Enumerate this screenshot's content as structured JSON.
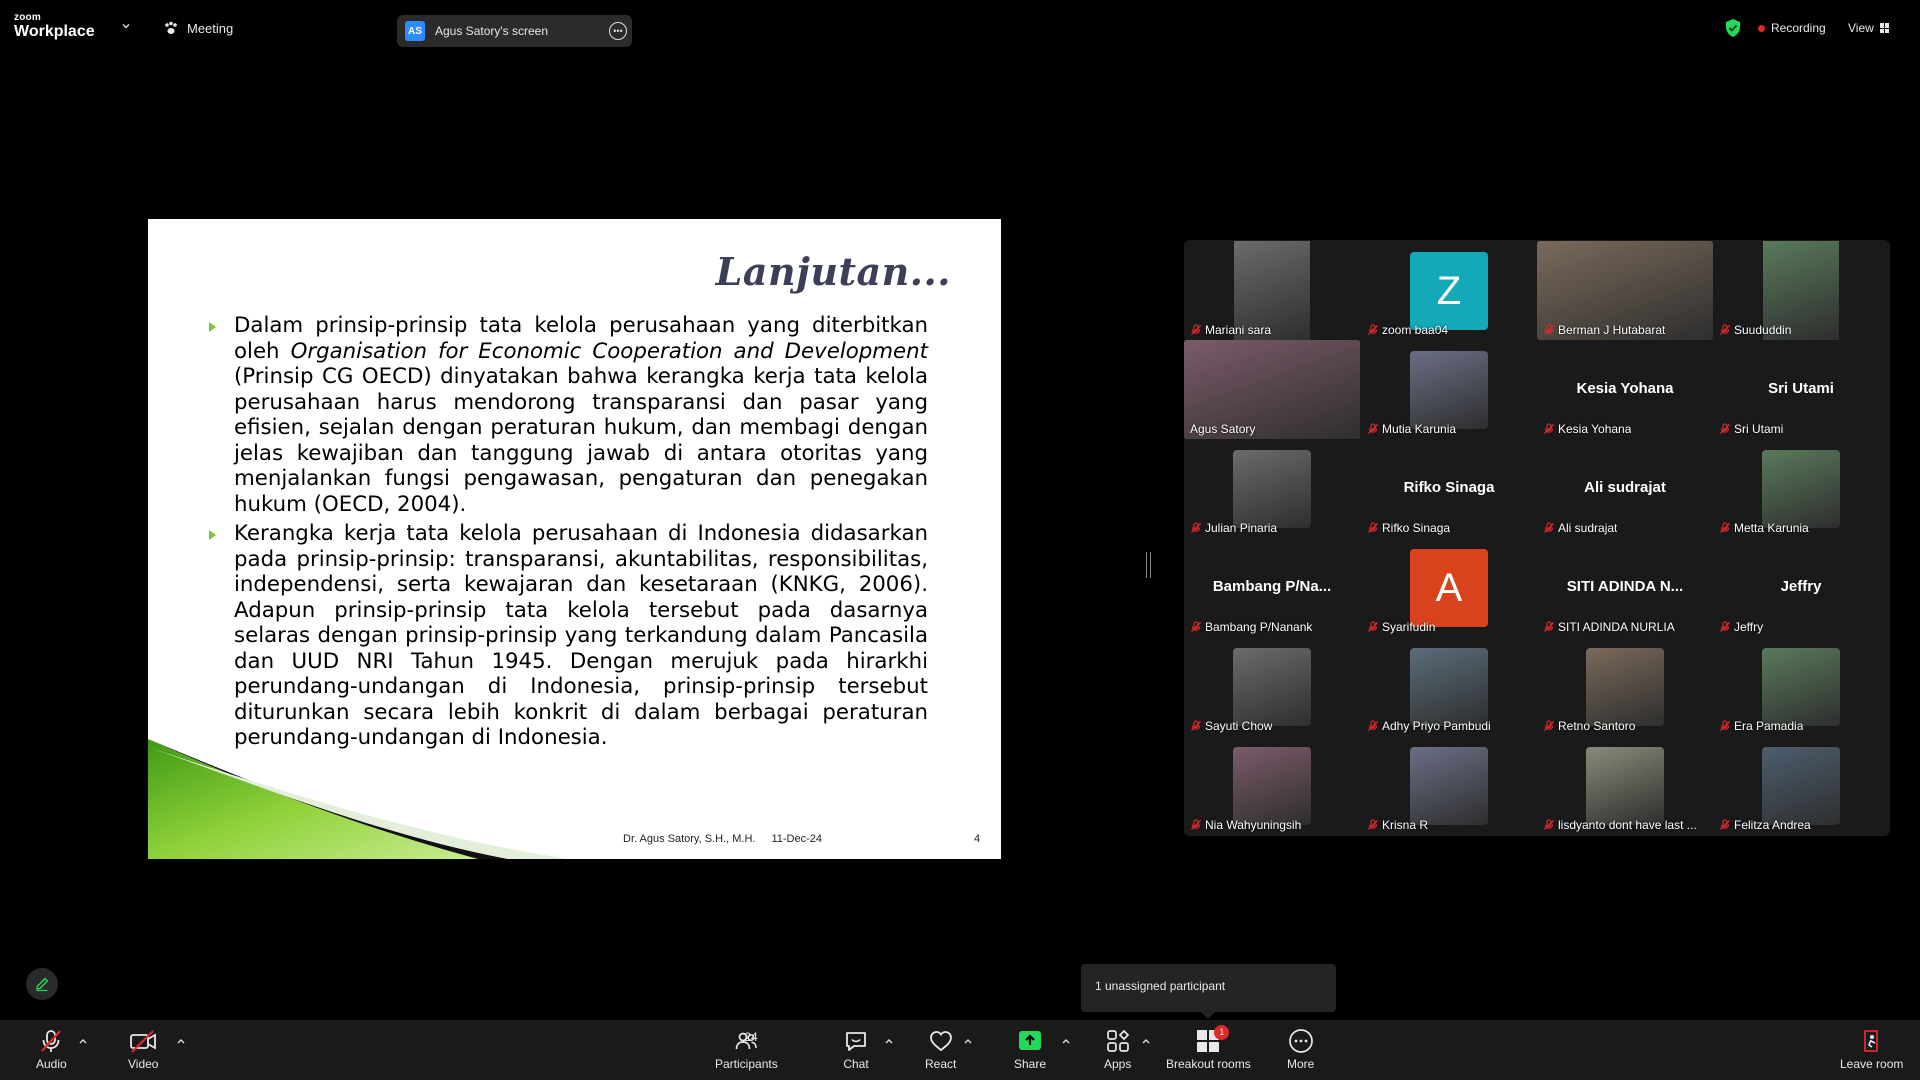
{
  "app": {
    "brand_small": "zoom",
    "brand_large": "Workplace",
    "meeting_label": "Meeting"
  },
  "screen_share": {
    "initials": "AS",
    "label": "Agus Satory's screen"
  },
  "status": {
    "recording_label": "Recording",
    "view_label": "View"
  },
  "slide": {
    "title": "Lanjutan...",
    "bullet1_pre": "Dalam prinsip-prinsip tata kelola perusahaan yang diterbitkan oleh ",
    "bullet1_italic": "Organisation for Economic Cooperation and Development",
    "bullet1_post": " (Prinsip CG OECD) dinyatakan bahwa kerangka kerja tata kelola perusahaan harus mendorong transparansi dan pasar yang efisien, sejalan dengan peraturan hukum, dan membagi dengan jelas kewajiban dan tanggung jawab di antara otoritas yang menjalankan fungsi pengawasan, pengaturan dan penegakan hukum (OECD, 2004).",
    "bullet2": "Kerangka kerja tata kelola perusahaan di Indonesia didasarkan pada prinsip-prinsip: transparansi, akuntabilitas, responsibilitas, independensi, serta kewajaran dan kesetaraan (KNKG, 2006). Adapun prinsip-prinsip tata kelola tersebut pada dasarnya selaras dengan prinsip-prinsip yang terkandung dalam Pancasila dan UUD NRI Tahun 1945. Dengan merujuk pada hirarkhi perundang-undangan di Indonesia, prinsip-prinsip tersebut diturunkan secara lebih konkrit di dalam berbagai peraturan perundang-undangan di Indonesia.",
    "footer_author": "Dr. Agus Satory, S.H., M.H.",
    "footer_date": "11-Dec-24",
    "page_number": "4"
  },
  "participants": [
    {
      "name": "Mariani sara",
      "kind": "video"
    },
    {
      "name": "zoom baa04",
      "kind": "letter",
      "letter": "Z",
      "color": "#14a9b8"
    },
    {
      "name": "Berman J Hutabarat",
      "kind": "video"
    },
    {
      "name": "Suududdin",
      "kind": "video"
    },
    {
      "name": "Agus Satory",
      "kind": "video",
      "active": true
    },
    {
      "name": "Mutia Karunia",
      "kind": "photo"
    },
    {
      "name": "Kesia Yohana",
      "kind": "name",
      "display": "Kesia Yohana"
    },
    {
      "name": "Sri Utami",
      "kind": "name",
      "display": "Sri Utami"
    },
    {
      "name": "Julian Pinaria",
      "kind": "photo"
    },
    {
      "name": "Rifko Sinaga",
      "kind": "name",
      "display": "Rifko Sinaga"
    },
    {
      "name": "Ali sudrajat",
      "kind": "name",
      "display": "Ali sudrajat"
    },
    {
      "name": "Metta Karunia",
      "kind": "photo"
    },
    {
      "name": "Bambang P/Nanank",
      "kind": "name",
      "display": "Bambang  P/Na..."
    },
    {
      "name": "Syarifudin",
      "kind": "letter",
      "letter": "A",
      "color": "#d8431e"
    },
    {
      "name": "SITI ADINDA NURLIA",
      "kind": "name",
      "display": "SITI ADINDA N..."
    },
    {
      "name": "Jeffry",
      "kind": "name",
      "display": "Jeffry"
    },
    {
      "name": "Sayuti Chow",
      "kind": "photo"
    },
    {
      "name": "Adhy Priyo Pambudi",
      "kind": "photo"
    },
    {
      "name": "Retno Santoro",
      "kind": "photo"
    },
    {
      "name": "Era Pamadia",
      "kind": "photo"
    },
    {
      "name": "Nia Wahyuningsih",
      "kind": "photo"
    },
    {
      "name": "Krisna R",
      "kind": "photo"
    },
    {
      "name": "lisdyanto dont have last ...",
      "kind": "photo"
    },
    {
      "name": "Felitza Andrea",
      "kind": "photo"
    }
  ],
  "tooltip": {
    "text": "1 unassigned participant"
  },
  "toolbar": {
    "audio": "Audio",
    "video": "Video",
    "participants": "Participants",
    "participant_count": "24",
    "chat": "Chat",
    "react": "React",
    "share": "Share",
    "apps": "Apps",
    "breakout": "Breakout rooms",
    "breakout_badge": "1",
    "more": "More",
    "leave": "Leave room"
  },
  "colors": {
    "accent_green": "#23d959",
    "zoom_blue": "#2d8cff",
    "alert_red": "#e02828",
    "slide_green": "#7ec437"
  }
}
